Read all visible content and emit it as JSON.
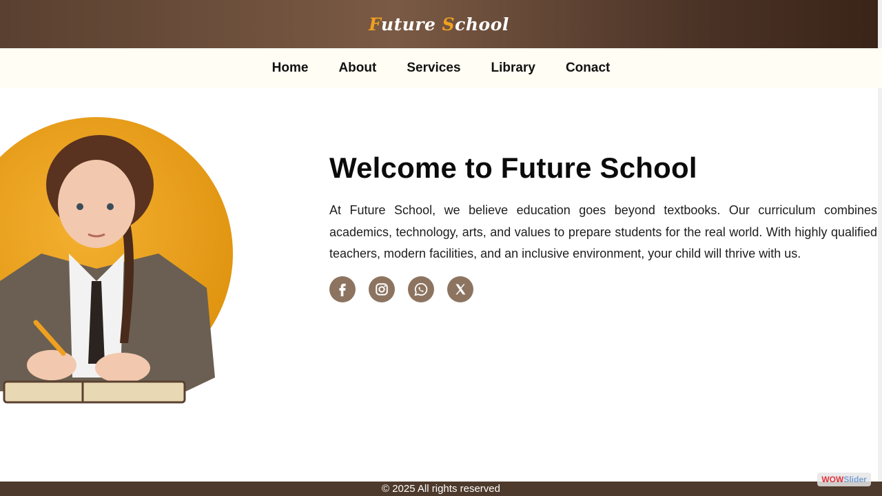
{
  "header": {
    "brand_first_initial": "F",
    "brand_first_rest": "uture ",
    "brand_second_initial": "S",
    "brand_second_rest": "chool"
  },
  "nav": {
    "items": [
      {
        "label": "Home"
      },
      {
        "label": "About"
      },
      {
        "label": "Services"
      },
      {
        "label": "Library"
      },
      {
        "label": "Conact"
      }
    ]
  },
  "hero": {
    "heading": "Welcome to Future School",
    "paragraph": "At Future School, we believe education goes beyond textbooks. Our curriculum combines academics, technology, arts, and values to prepare students for the real world. With highly qualified teachers, modern facilities, and an inclusive environment, your child will thrive with us.",
    "socials": [
      {
        "icon": "facebook-icon"
      },
      {
        "icon": "instagram-icon"
      },
      {
        "icon": "whatsapp-icon"
      },
      {
        "icon": "x-icon"
      }
    ]
  },
  "footer": {
    "copyright": "© 2025 All rights reserved"
  },
  "overlay_badge": {
    "part1": "WOW",
    "part2": "Slider"
  },
  "colors": {
    "accent_orange": "#f0a020",
    "header_brown": "#5a4030",
    "social_brown": "#8c7460"
  }
}
